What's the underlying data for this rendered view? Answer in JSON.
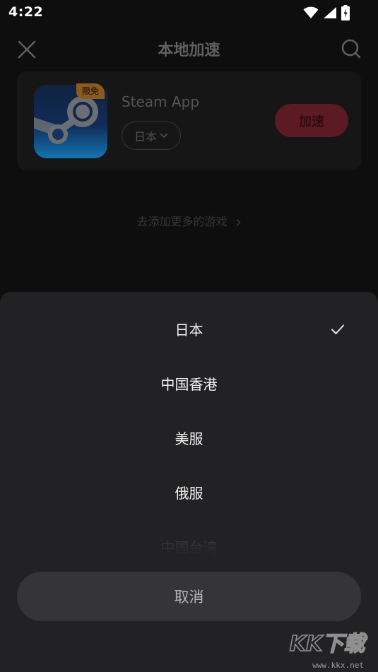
{
  "status_bar": {
    "time": "4:22",
    "icons": [
      "wifi-icon",
      "signal-icon",
      "battery-charging-icon"
    ]
  },
  "header": {
    "title": "本地加速",
    "left_icon": "close-icon",
    "right_icon": "search-icon"
  },
  "game_card": {
    "name": "Steam App",
    "badge": "限免",
    "region": "日本",
    "accelerate_label": "加速",
    "icon": "steam-logo-icon"
  },
  "add_more_link": "去添加更多的游戏",
  "region_sheet": {
    "options": [
      {
        "label": "日本",
        "selected": true
      },
      {
        "label": "中国香港",
        "selected": false
      },
      {
        "label": "美服",
        "selected": false
      },
      {
        "label": "俄服",
        "selected": false
      },
      {
        "label": "中国台湾",
        "selected": false
      }
    ],
    "cancel_label": "取消"
  },
  "watermark": {
    "logo_text": "KK下载",
    "url": "www.kkx.net"
  },
  "colors": {
    "sheet_bg": "#222224",
    "accent_red": "#c8283c",
    "badge_orange": "#e0912f"
  }
}
